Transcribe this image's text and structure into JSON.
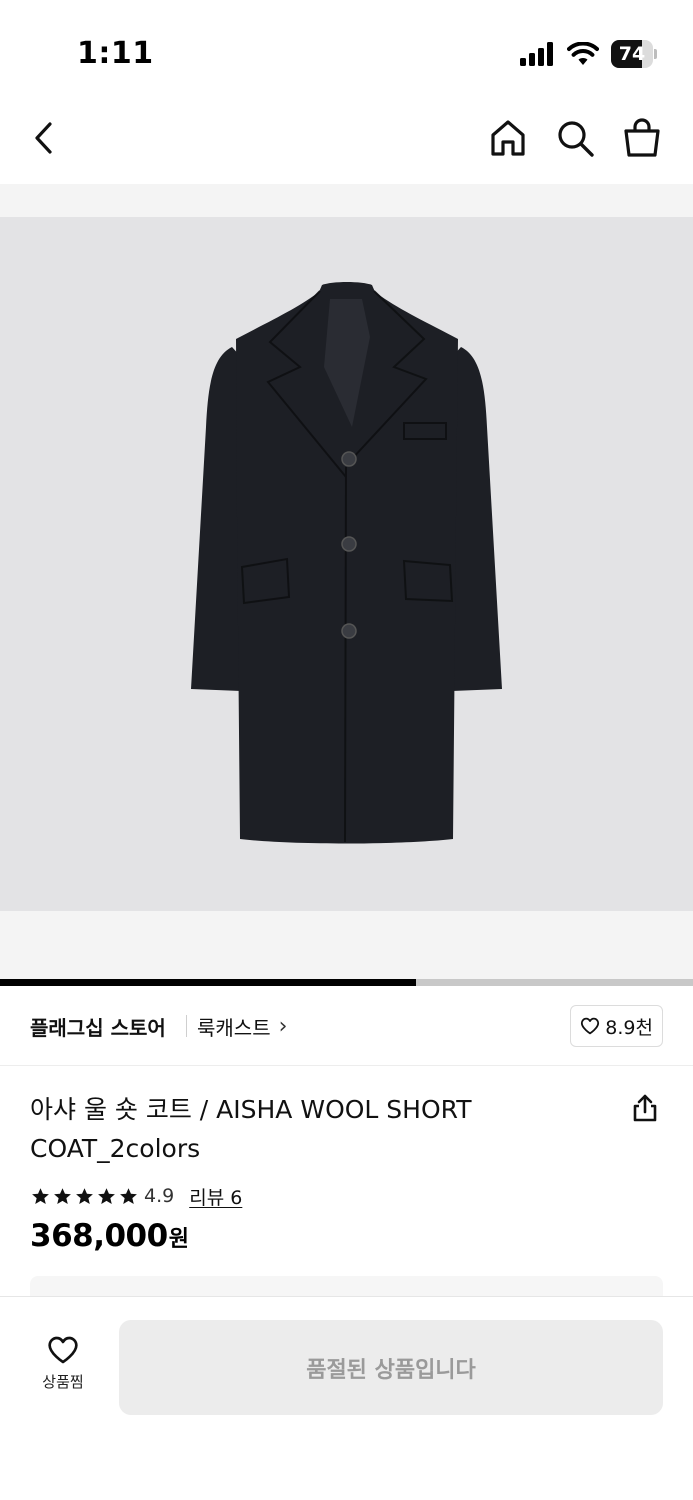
{
  "status_bar": {
    "time": "1:11",
    "battery_level": "74",
    "battery_fraction": 0.74
  },
  "nav": {
    "back_icon": "chevron-left-icon",
    "home_icon": "home-icon",
    "search_icon": "search-icon",
    "cart_icon": "shopping-bag-icon"
  },
  "gallery": {
    "image_subject": "black wool coat",
    "progress_fraction": 0.6
  },
  "store": {
    "store_label": "플래그십 스토어",
    "brand_name": "룩캐스트",
    "brand_chevron": "›",
    "like_count": "8.9천",
    "like_icon": "heart-outline-icon"
  },
  "product": {
    "title": "아샤 울 숏 코트 / AISHA WOOL SHORT COAT_2colors",
    "share_icon": "share-icon",
    "rating_stars": 5,
    "rating": "4.9",
    "review_link": "리뷰 6",
    "price": "368,000",
    "price_unit": "원"
  },
  "bottom_bar": {
    "wish_label": "상품찜",
    "wish_icon": "heart-outline-icon",
    "soldout_label": "품절된 상품입니다"
  },
  "colors": {
    "accent": "#000000",
    "image_bg": "#e3e3e5",
    "coat": "#1d1f25",
    "disabled_bg": "#ececec",
    "disabled_text": "#9a9a9a"
  }
}
